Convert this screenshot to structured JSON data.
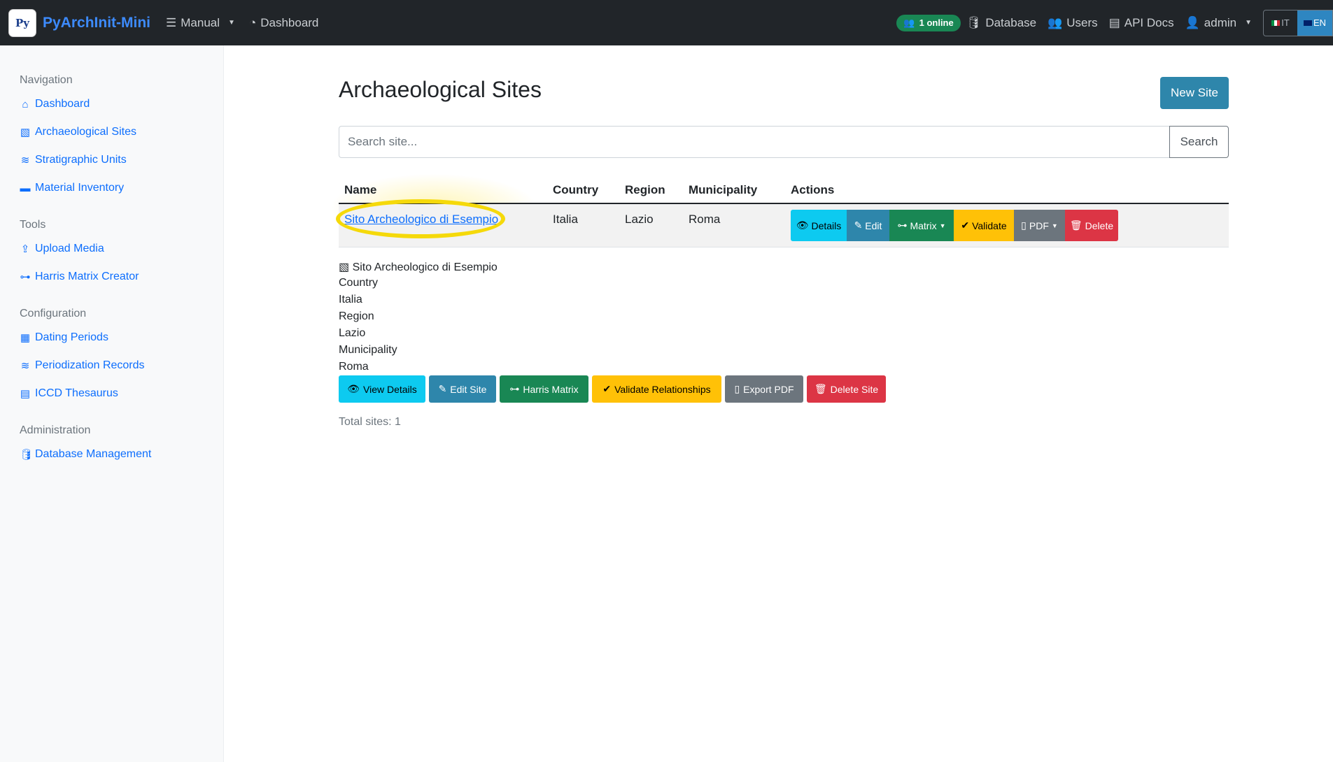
{
  "header": {
    "brand": "PyArchInit-Mini",
    "logo_text": "Py",
    "nav_left": [
      {
        "label": "Manual",
        "icon": "list-icon"
      },
      {
        "label": "Dashboard",
        "icon": "gauge-icon"
      }
    ],
    "online_badge": "1 online",
    "nav_right": [
      {
        "label": "Database",
        "icon": "database-icon"
      },
      {
        "label": "Users",
        "icon": "users-icon"
      },
      {
        "label": "API Docs",
        "icon": "book-icon"
      },
      {
        "label": "admin",
        "icon": "user-icon"
      }
    ],
    "lang": {
      "it": "IT",
      "en": "EN",
      "active": "EN"
    }
  },
  "sidebar": {
    "sections": [
      {
        "title": "Navigation",
        "items": [
          "Dashboard",
          "Archaeological Sites",
          "Stratigraphic Units",
          "Material Inventory"
        ]
      },
      {
        "title": "Tools",
        "items": [
          "Upload Media",
          "Harris Matrix Creator"
        ]
      },
      {
        "title": "Configuration",
        "items": [
          "Dating Periods",
          "Periodization Records",
          "ICCD Thesaurus"
        ]
      },
      {
        "title": "Administration",
        "items": [
          "Database Management"
        ]
      }
    ]
  },
  "main": {
    "title": "Archaeological Sites",
    "new_button": "New Site",
    "search": {
      "placeholder": "Search site...",
      "button": "Search"
    },
    "table": {
      "columns": [
        "Name",
        "Country",
        "Region",
        "Municipality",
        "Actions"
      ],
      "rows": [
        {
          "name": "Sito Archeologico di Esempio",
          "country": "Italia",
          "region": "Lazio",
          "municipality": "Roma"
        }
      ],
      "actions": [
        "Details",
        "Edit",
        "Matrix",
        "Validate",
        "PDF",
        "Delete"
      ]
    },
    "detail": {
      "name": "Sito Archeologico di Esempio",
      "fields": [
        "Country",
        "Italia",
        "Region",
        "Lazio",
        "Municipality",
        "Roma"
      ],
      "buttons": [
        "View Details",
        "Edit Site",
        "Harris Matrix",
        "Validate Relationships",
        "Export PDF",
        "Delete Site"
      ]
    },
    "total": "Total sites: 1"
  },
  "colors": {
    "navbar": "#212529",
    "info": "#0dcaf0",
    "primary_teal": "#2e86ab",
    "success": "#198754",
    "warning": "#ffc107",
    "secondary": "#6c757d",
    "danger": "#dc3545",
    "highlight": "#f5d90a"
  }
}
